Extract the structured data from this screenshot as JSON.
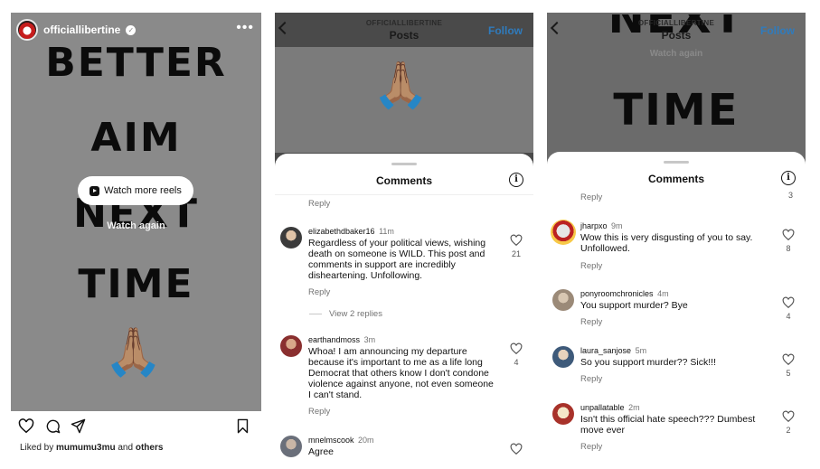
{
  "reel": {
    "username": "officiallibertine",
    "verified_mark": "✓",
    "more_icon": "more-horizontal-icon",
    "words": [
      "BETTER",
      "AIM",
      "NEXT",
      "TIME"
    ],
    "emoji": "🙏🏽",
    "watch_more_label": "Watch more reels",
    "watch_again_label": "Watch again",
    "liked_prefix": "Liked by ",
    "liked_user": "mumumu3mu",
    "liked_mid": " and ",
    "liked_others": "others"
  },
  "posts_panel": {
    "nav_user": "OFFICIALLIBERTINE",
    "nav_title": "Posts",
    "follow_label": "Follow",
    "emoji": "🙏🏽",
    "sheet_title": "Comments",
    "top_reply": "Reply",
    "comments": [
      {
        "user": "elizabethdbaker16",
        "time": "11m",
        "text": "Regardless of your political views, wishing death on someone is WILD. This post and comments in support are incredibly disheartening. Unfollowing.",
        "likes": "21",
        "reply": "Reply",
        "view_replies": "View 2 replies"
      },
      {
        "user": "earthandmoss",
        "time": "3m",
        "text": "Whoa! I am announcing my departure because it's important to me as a life long Democrat that others know I don't condone violence against anyone, not even someone I can't stand.",
        "likes": "4",
        "reply": "Reply"
      },
      {
        "user": "mnelmscook",
        "time": "20m",
        "text": "Agree",
        "likes": ""
      }
    ]
  },
  "comments_panel": {
    "nav_user": "OFFICIALLIBERTINE",
    "nav_title": "Posts",
    "follow_label": "Follow",
    "bg_word_1": "NEXT",
    "bg_word_2": "TIME",
    "watch_again_label": "Watch again",
    "sheet_title": "Comments",
    "top_reply": "Reply",
    "top_likes": "3",
    "comments": [
      {
        "user": "jharpxo",
        "time": "9m",
        "text": "Wow this is very disgusting of you to say. Unfollowed.",
        "likes": "8",
        "reply": "Reply"
      },
      {
        "user": "ponyroomchronicles",
        "time": "4m",
        "text": "You support murder? Bye",
        "likes": "4",
        "reply": "Reply"
      },
      {
        "user": "laura_sanjose",
        "time": "5m",
        "text": "So you support murder?? Sick!!!",
        "likes": "5",
        "reply": "Reply"
      },
      {
        "user": "unpallatable",
        "time": "2m",
        "text": "Isn't this official hate speech??? Dumbest move ever",
        "likes": "2",
        "reply": "Reply"
      }
    ]
  }
}
